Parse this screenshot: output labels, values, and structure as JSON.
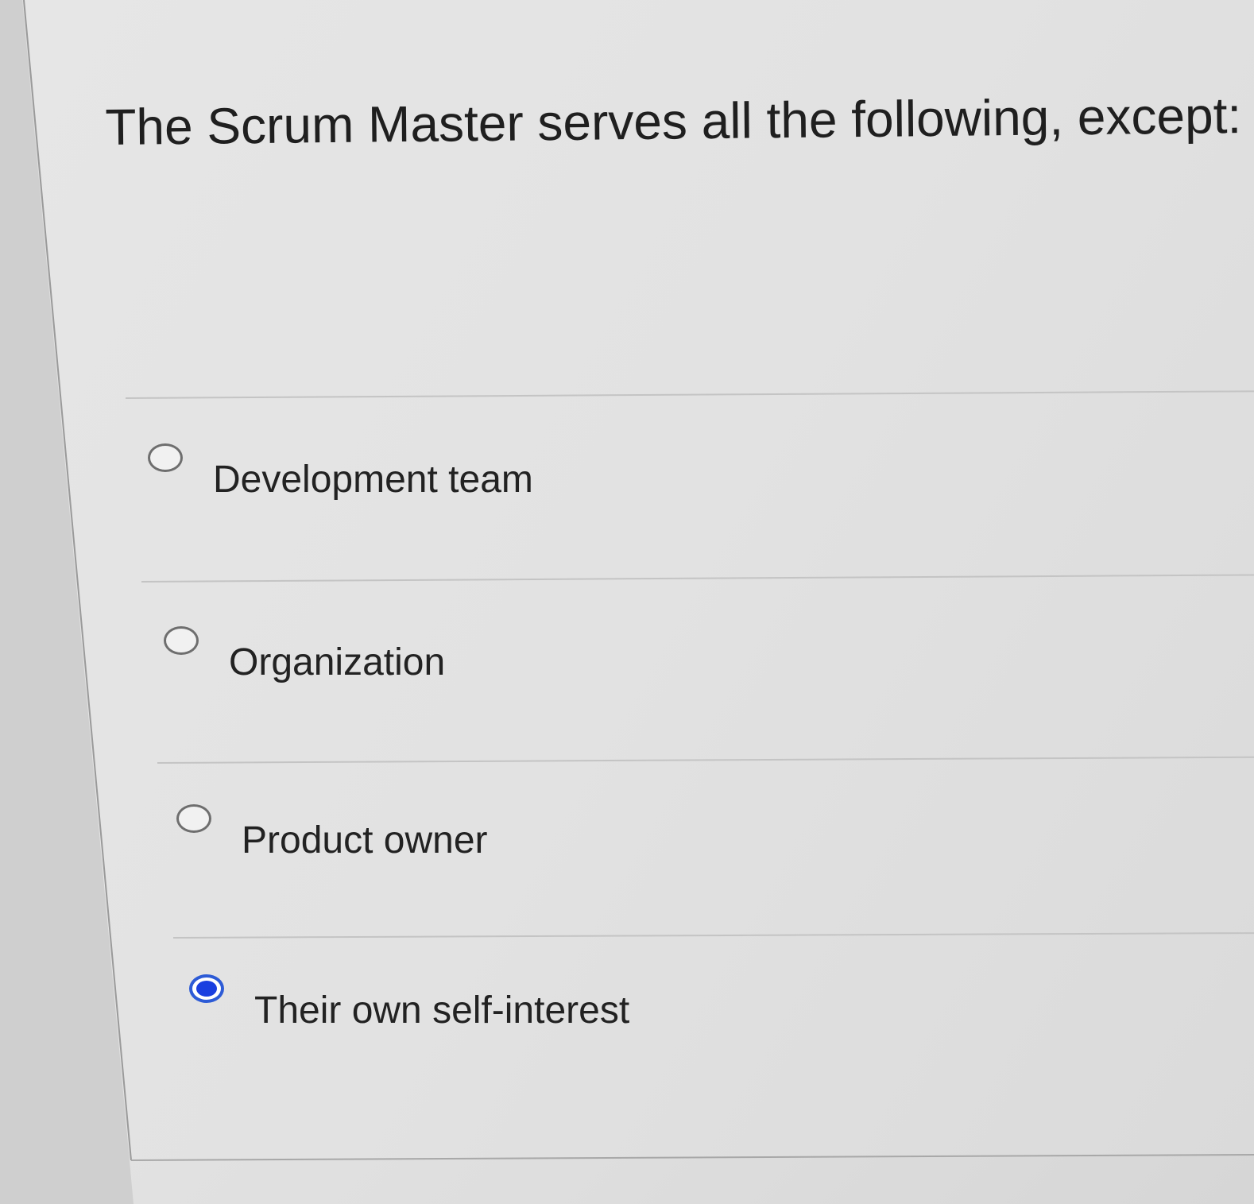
{
  "question": {
    "text": "The Scrum Master serves all the following, except:"
  },
  "options": [
    {
      "label": "Development team",
      "selected": false
    },
    {
      "label": "Organization",
      "selected": false
    },
    {
      "label": "Product owner",
      "selected": false
    },
    {
      "label": "Their own self-interest",
      "selected": true
    }
  ],
  "colors": {
    "selected_radio": "#1a3fe0",
    "unselected_radio_border": "#6e6e6e",
    "text": "#1f1f1f"
  }
}
